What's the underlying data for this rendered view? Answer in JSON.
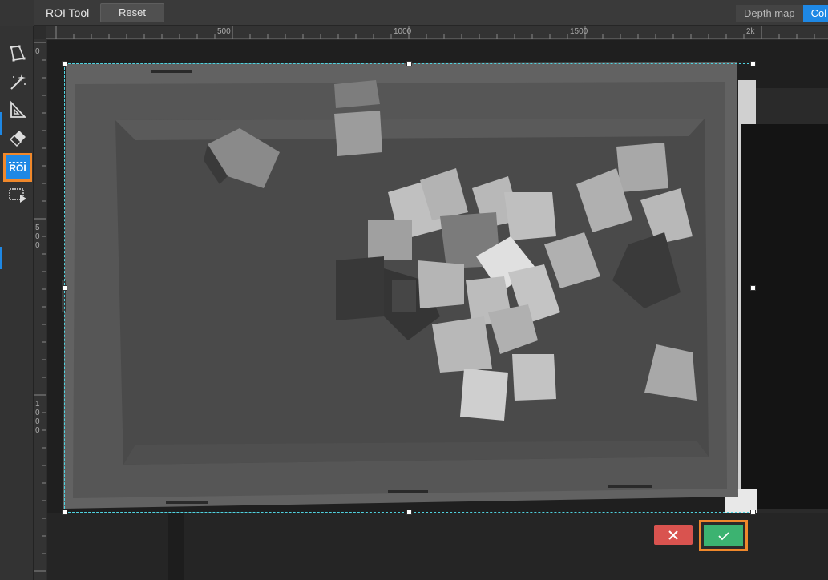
{
  "header": {
    "title": "ROI Tool",
    "reset_label": "Reset",
    "view_tabs": [
      "Depth map",
      "Col"
    ],
    "active_tab": 1
  },
  "toolbar": {
    "tools": [
      "polygon-select-icon",
      "magic-wand-icon",
      "ruler-triangle-icon",
      "eraser-icon",
      "roi-icon",
      "roi-play-icon"
    ],
    "roi_label": "ROI",
    "active_tool": "roi-icon"
  },
  "rulers": {
    "top_labels": [
      "500",
      "1000",
      "1500",
      "2k"
    ],
    "left_labels": [
      [
        "0"
      ],
      [
        "5",
        "0",
        "0"
      ],
      [
        "1",
        "0",
        "0",
        "0"
      ]
    ]
  },
  "actions": {
    "cancel_icon": "close-icon",
    "confirm_icon": "check-icon"
  },
  "colors": {
    "accent": "#1e88e5",
    "highlight": "#f0882b",
    "cancel": "#d9534f",
    "confirm": "#3cb371",
    "roi_border": "#4fd3e0"
  }
}
